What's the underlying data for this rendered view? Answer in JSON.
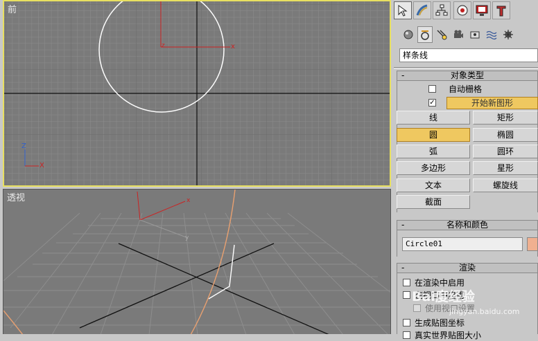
{
  "viewports": {
    "front": {
      "label": "前"
    },
    "perspective": {
      "label": "透视"
    }
  },
  "panel": {
    "tabs": [
      "select-icon",
      "create-icon",
      "modify-icon",
      "hierarchy-icon",
      "motion-icon",
      "display-icon",
      "utilities-icon"
    ],
    "subtabs": [
      "geometry-icon",
      "shapes-icon",
      "lights-icon",
      "cameras-icon",
      "helpers-icon",
      "spacewarps-icon",
      "systems-icon"
    ],
    "category": "样条线",
    "object_type": {
      "header": "对象类型",
      "autogrid_label": "自动栅格",
      "start_new_label": "开始新图形",
      "buttons": [
        {
          "label": "线"
        },
        {
          "label": "矩形"
        },
        {
          "label": "圆"
        },
        {
          "label": "椭圆"
        },
        {
          "label": "弧"
        },
        {
          "label": "圆环"
        },
        {
          "label": "多边形"
        },
        {
          "label": "星形"
        },
        {
          "label": "文本"
        },
        {
          "label": "螺旋线"
        },
        {
          "label": "截面"
        }
      ],
      "active": "圆"
    },
    "name_color": {
      "header": "名称和颜色",
      "name": "Circle01",
      "color": "#f0b090"
    },
    "render": {
      "header": "渲染",
      "enable_in_renderer": "在渲染中启用",
      "enable_in_viewport": "在视口中启用",
      "use_viewport_settings": "使用视口设置",
      "gen_mapping_coords": "生成贴图坐标",
      "real_world_map_size": "真实世界贴图大小"
    }
  },
  "watermark": {
    "brand": "Bai度经验",
    "url": "jingyan.baidu.com"
  },
  "colors": {
    "active_border": "#e8e060",
    "accent": "#efc860"
  }
}
